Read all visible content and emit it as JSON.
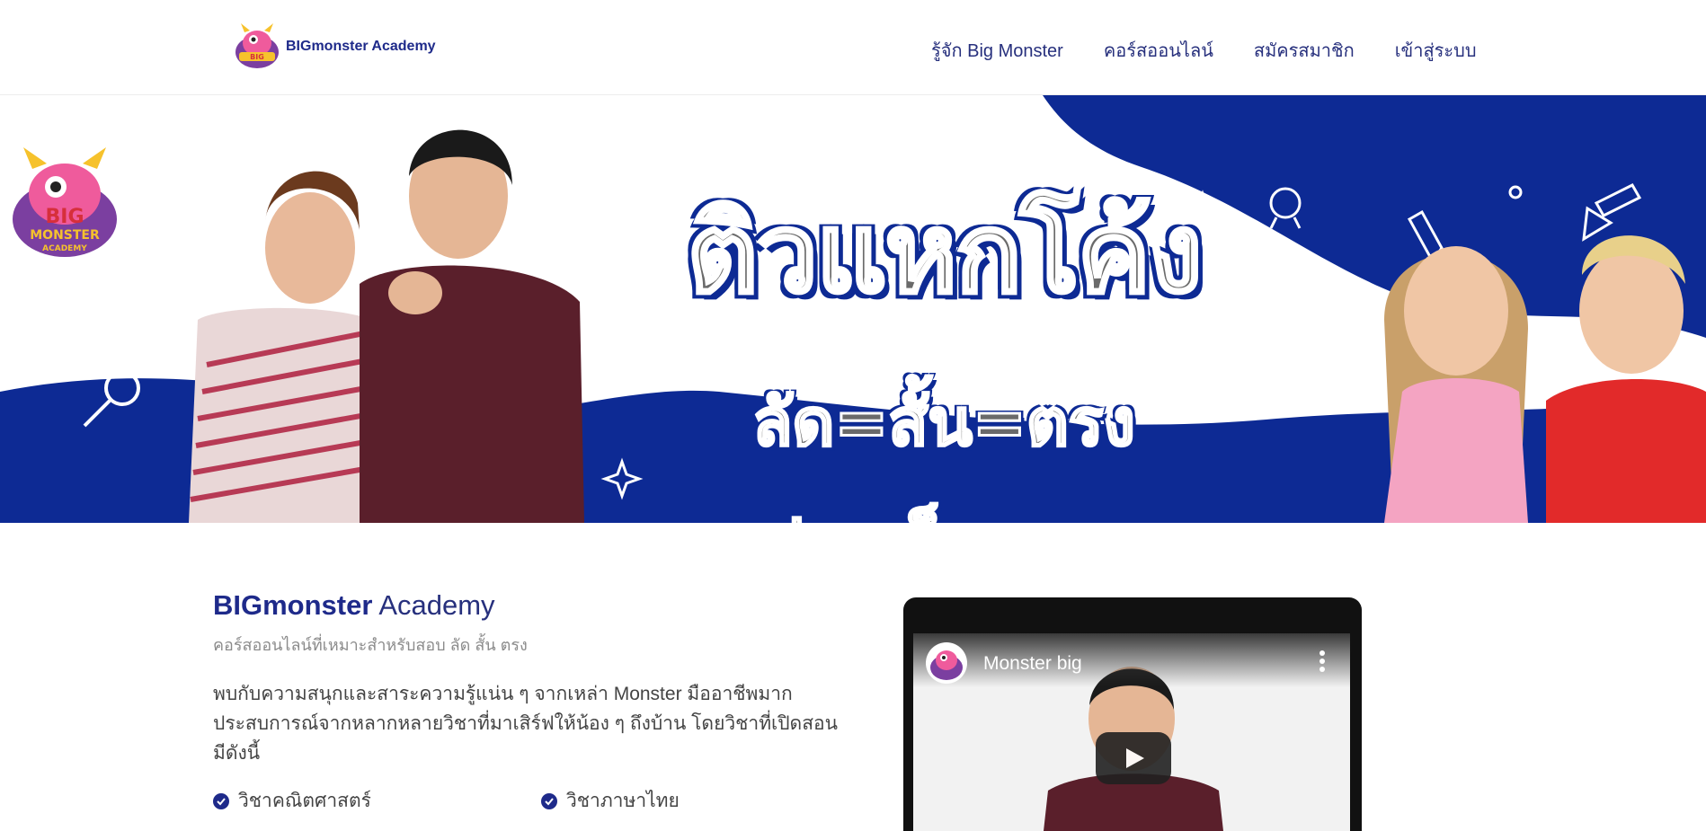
{
  "header": {
    "brand_name": "BIGmonster Academy",
    "nav": [
      {
        "label": "รู้จัก Big Monster"
      },
      {
        "label": "คอร์สออนไลน์"
      },
      {
        "label": "สมัครสมาชิก"
      },
      {
        "label": "เข้าสู่ระบบ"
      }
    ]
  },
  "hero": {
    "logo_text": [
      "BIG",
      "MONSTER",
      "ACADEMY"
    ],
    "line1": "ติวแหกโค้ง",
    "line2": "ลัด=สั้น=ตรง",
    "line3": "ทุกประเด็นออกสอบ",
    "slides": 3,
    "active_slide": 1
  },
  "content": {
    "title_bold": "BIGmonster",
    "title_rest": " Academy",
    "subtitle": "คอร์สออนไลน์ที่เหมาะสำหรับสอบ ลัด สั้น ตรง",
    "description": "พบกับความสนุกและสาระความรู้แน่น ๆ จากเหล่า Monster มืออาชีพมาก ประสบการณ์จากหลากหลายวิชาที่มาเสิร์ฟให้น้อง ๆ ถึงบ้าน โดยวิชาที่เปิดสอนมีดังนี้",
    "subjects": [
      "วิชาคณิตศาสตร์",
      "วิชาภาษาไทย"
    ]
  },
  "video": {
    "channel_name": "Monster big"
  },
  "colors": {
    "brand_navy": "#1e2a8a",
    "hero_blue": "#0d2a94",
    "nav_text": "#27307d"
  }
}
